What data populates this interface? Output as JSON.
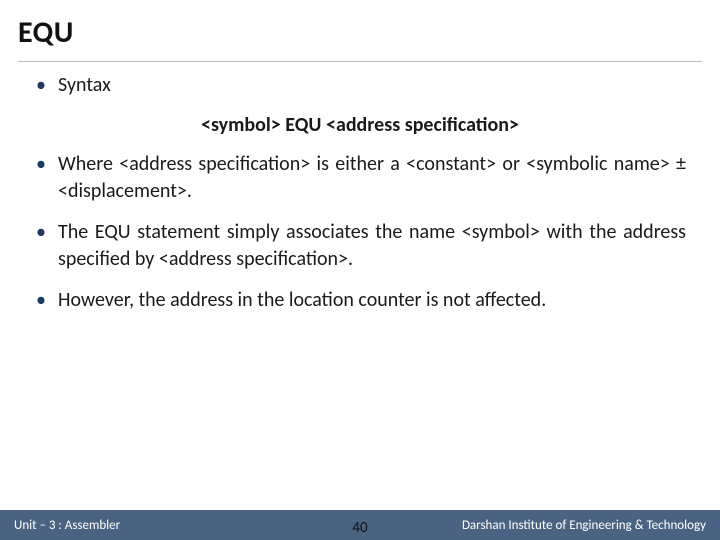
{
  "title": "EQU",
  "bullets": {
    "b1": "Syntax",
    "syntax_line": "<symbol> EQU <address specification>",
    "b2": "Where <address specification> is either a <constant> or <symbolic name> ± <displacement>.",
    "b3": "The EQU statement simply associates the name <symbol> with the address specified by <address specification>.",
    "b4": "However, the address in the location counter is not affected."
  },
  "footer": {
    "left": "Unit – 3 : Assembler",
    "page": "40",
    "right": "Darshan Institute of Engineering & Technology"
  }
}
